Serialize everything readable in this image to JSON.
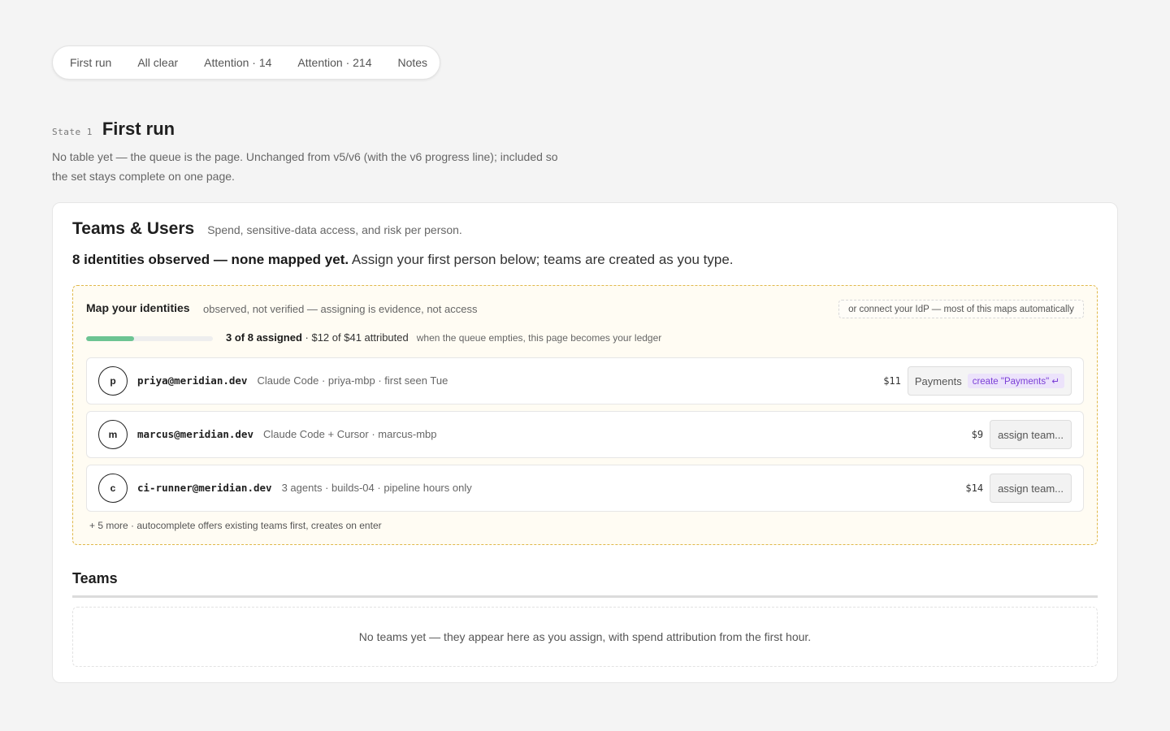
{
  "state_tabs": [
    "First run",
    "All clear",
    "Attention · 14",
    "Attention · 214",
    "Notes"
  ],
  "state": {
    "number_label": "State 1",
    "title": "First run",
    "description": "No table yet — the queue is the page. Unchanged from v5/v6 (with the v6 progress line); included so the set stays complete on one page."
  },
  "card": {
    "title": "Teams & Users",
    "subtitle": "Spend, sensitive-data access, and risk per person.",
    "headline_bold": "8 identities observed — none mapped yet.",
    "headline_rest": " Assign your first person below; teams are created as you type."
  },
  "map": {
    "title": "Map your identities",
    "note": "observed, not verified — assigning is evidence, not access",
    "idp_link": "or connect your IdP — most of this maps automatically",
    "progress": {
      "fraction": 0.375,
      "assigned_text": "3 of 8 assigned",
      "attributed_text": " · $12 of $41 attributed",
      "hint": "when the queue empties, this page becomes your ledger"
    },
    "identities": [
      {
        "initial": "p",
        "email": "priya@meridian.dev",
        "meta": "Claude Code · priya-mbp · first seen Tue",
        "cost": "$11",
        "team_value": "Payments",
        "create_hint": "create \"Payments\" ↵"
      },
      {
        "initial": "m",
        "email": "marcus@meridian.dev",
        "meta": "Claude Code + Cursor · marcus-mbp",
        "cost": "$9",
        "assign_label": "assign team..."
      },
      {
        "initial": "c",
        "email": "ci-runner@meridian.dev",
        "meta": "3 agents · builds-04 · pipeline hours only",
        "cost": "$14",
        "assign_label": "assign team..."
      }
    ],
    "more": "+ 5 more · autocomplete offers existing teams first, creates on enter"
  },
  "teams": {
    "title": "Teams",
    "empty": "No teams yet — they appear here as you assign, with spend attribution from the first hour."
  },
  "colors": {
    "page_bg": "#f4f4f4",
    "progress_fill": "#6cc492",
    "queue_border": "#e0b84a",
    "create_chip": "#7b3fd6"
  }
}
